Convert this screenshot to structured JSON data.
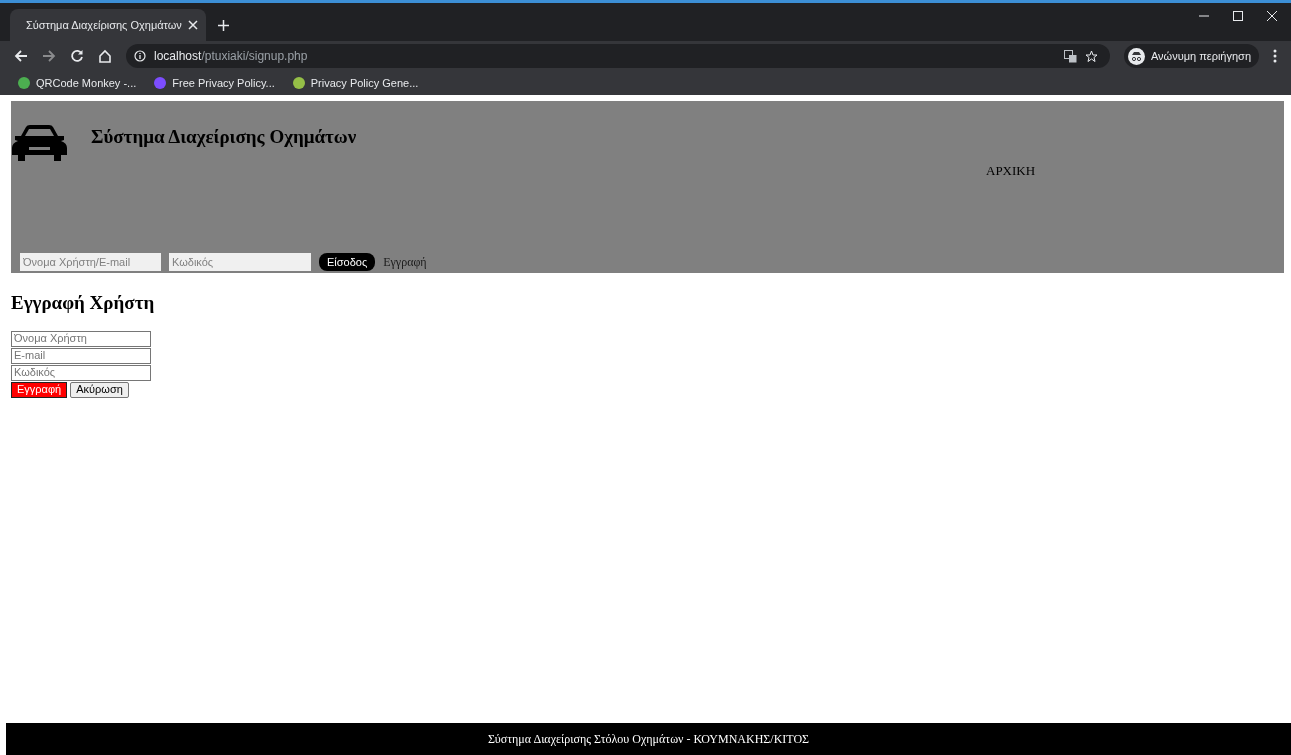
{
  "browser": {
    "tab_title": "Σύστημα Διαχείρισης Οχημάτων",
    "url_host": "localhost",
    "url_path": "/ptuxiaki/signup.php",
    "profile": "Ανώνυμη περιήγηση",
    "bookmarks": [
      {
        "label": "QRCode Monkey -...",
        "color": "#4caf50"
      },
      {
        "label": "Free Privacy Policy...",
        "color": "#7c4dff"
      },
      {
        "label": "Privacy Policy Gene...",
        "color": "#95bf47"
      }
    ]
  },
  "header": {
    "title": "Σύστημα Διαχείρισης Οχημάτων",
    "nav": [
      "ΑΡΧΙΚΗ"
    ],
    "login": {
      "username_placeholder": "Όνομα Χρήστη/E-mail",
      "password_placeholder": "Κωδικός",
      "submit": "Είσοδος",
      "register_link": "Εγγραφή"
    }
  },
  "signup": {
    "heading": "Εγγραφή Χρήστη",
    "fields": [
      {
        "placeholder": "Όνομα Χρήστη"
      },
      {
        "placeholder": "E-mail"
      },
      {
        "placeholder": "Κωδικός"
      }
    ],
    "buttons": [
      {
        "label": "Εγγραφή",
        "kind": "primary"
      },
      {
        "label": "Ακύρωση",
        "kind": "secondary"
      }
    ]
  },
  "footer": "Σύστημα Διαχείρισης Στόλου Οχημάτων - ΚΟΥΜΝΑΚΗΣ/ΚΙΤΟΣ"
}
